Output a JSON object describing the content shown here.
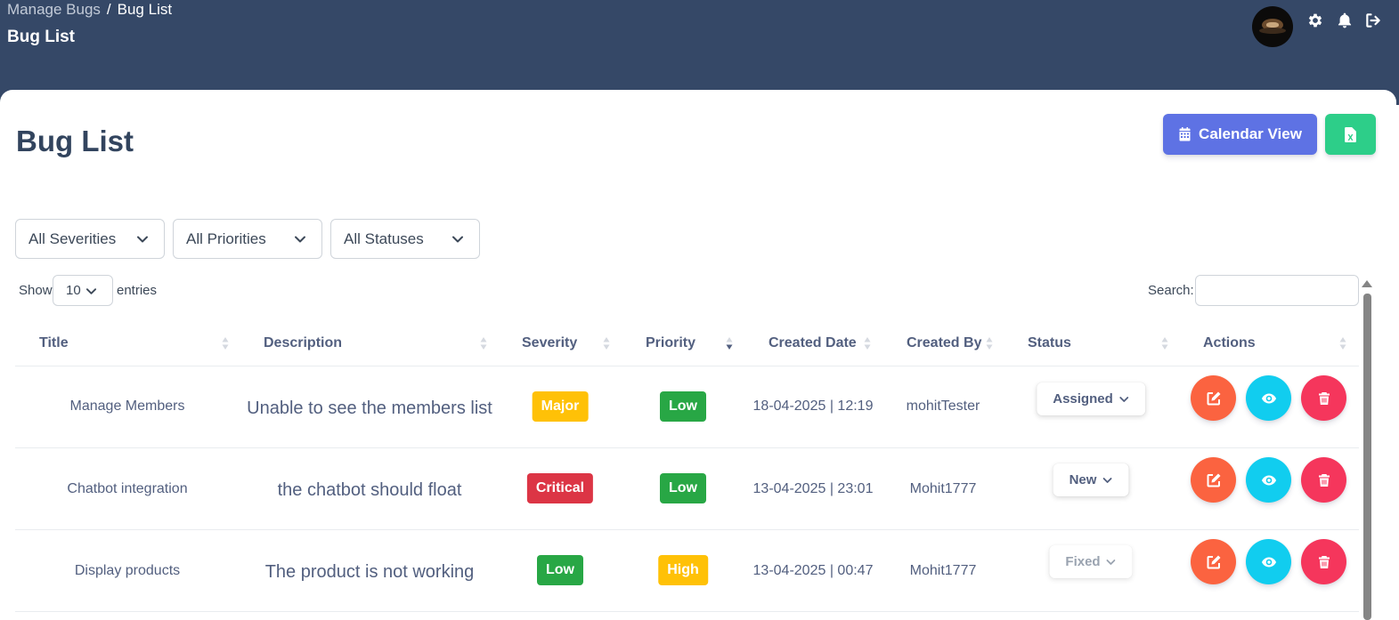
{
  "breadcrumb": {
    "parent": "Manage Bugs",
    "separator": "/",
    "current": "Bug List"
  },
  "header": {
    "title": "Bug List"
  },
  "page": {
    "title": "Bug List"
  },
  "toolbar": {
    "calendar_label": "Calendar View",
    "export_icon": "excel-file-icon"
  },
  "top_icons": [
    "gear-icon",
    "bell-icon",
    "logout-icon"
  ],
  "filters": [
    {
      "value": "All Severities"
    },
    {
      "value": "All Priorities"
    },
    {
      "value": "All Statuses"
    }
  ],
  "length_menu": {
    "show_label": "Show",
    "value": "10",
    "entries_label": "entries"
  },
  "search": {
    "label": "Search:",
    "value": "",
    "placeholder": ""
  },
  "table": {
    "columns": [
      "Title",
      "Description",
      "Severity",
      "Priority",
      "Created Date",
      "Created By",
      "Status",
      "Actions"
    ],
    "sorted_column": "Priority",
    "rows": [
      {
        "title": "Manage Members",
        "description": "Unable to see the members list",
        "severity": "Major",
        "priority": "Low",
        "created_date": "18-04-2025 | 12:19",
        "created_by": "mohitTester",
        "status": "Assigned"
      },
      {
        "title": "Chatbot integration",
        "description": "the chatbot should float",
        "severity": "Critical",
        "priority": "Low",
        "created_date": "13-04-2025 | 23:01",
        "created_by": "Mohit1777",
        "status": "New"
      },
      {
        "title": "Display products",
        "description": "The product is not working",
        "severity": "Low",
        "priority": "High",
        "created_date": "13-04-2025 | 00:47",
        "created_by": "Mohit1777",
        "status": "Fixed"
      }
    ]
  },
  "colors": {
    "header_bg": "#354867",
    "primary": "#5e72e4",
    "success": "#2dce89",
    "badge_major": "#ffc107",
    "badge_critical": "#dc3545",
    "badge_low": "#28a745",
    "badge_high": "#ffc107",
    "edit": "#fb6340",
    "view": "#11cdef",
    "delete": "#f5365c"
  }
}
